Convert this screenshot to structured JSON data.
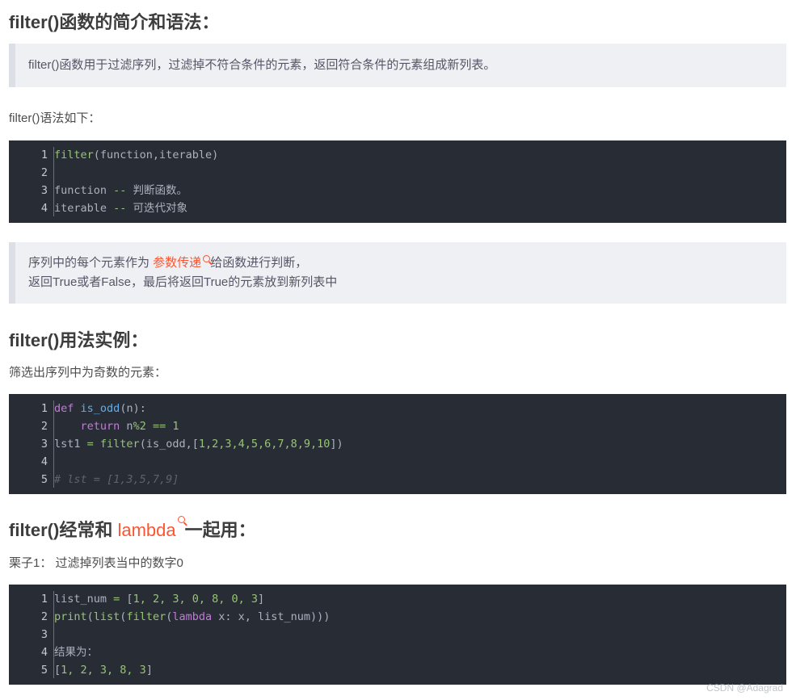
{
  "section1": {
    "heading": "filter()函数的简介和语法：",
    "quote": "filter()函数用于过滤序列，过滤掉不符合条件的元素，返回符合条件的元素组成新列表。",
    "syntax_intro": "filter()语法如下："
  },
  "code1": {
    "line_numbers": [
      "1",
      "2",
      "3",
      "4"
    ],
    "lines": {
      "l1": {
        "fn": "filter",
        "rest": "(function,iterable)"
      },
      "l3": {
        "a": "function ",
        "op": "--",
        "b": " 判断函数。"
      },
      "l4": {
        "a": "iterable ",
        "op": "--",
        "b": " 可迭代对象"
      }
    }
  },
  "quote2": {
    "before_link": "序列中的每个元素作为 ",
    "link": "参数传递",
    "after_link": "给函数进行判断，",
    "line2": "返回True或者False，最后将返回True的元素放到新列表中"
  },
  "section2": {
    "heading": "filter()用法实例：",
    "intro": "筛选出序列中为奇数的元素："
  },
  "code2": {
    "line_numbers": [
      "1",
      "2",
      "3",
      "4",
      "5"
    ],
    "l1": {
      "kw": "def",
      "sp": " ",
      "fn": "is_odd",
      "rest": "(n):"
    },
    "l2": {
      "indent": "    ",
      "kw": "return",
      "a": " n",
      "op": "%",
      "num1": "2",
      "sp": " ",
      "eq": "==",
      "sp2": " ",
      "num2": "1"
    },
    "l3": {
      "a": "lst1 ",
      "op": "=",
      "sp": " ",
      "bi": "filter",
      "b": "(is_odd,[",
      "nums": "1,2,3,4,5,6,7,8,9,10",
      "c": "])"
    },
    "l5": {
      "cm": "# lst = [1,3,5,7,9]"
    }
  },
  "section3": {
    "heading_before": "filter()经常和 ",
    "heading_link": "lambda",
    "heading_after": "一起用：",
    "example": "栗子1： 过滤掉列表当中的数字0"
  },
  "code3": {
    "line_numbers": [
      "1",
      "2",
      "3",
      "4",
      "5"
    ],
    "l1": {
      "a": "list_num ",
      "op": "=",
      "b": " [",
      "nums": "1, 2, 3, 0, 8, 0, 3",
      "c": "]"
    },
    "l2": {
      "bi1": "print",
      "p1": "(",
      "bi2": "list",
      "p2": "(",
      "bi3": "filter",
      "p3": "(",
      "kw": "lambda",
      "rest": " x: x, list_num)))"
    },
    "l4": {
      "text": "结果为："
    },
    "l5": {
      "a": "[",
      "nums": "1, 2, 3, 8, 3",
      "c": "]"
    }
  },
  "watermark": "CSDN @Adagrad"
}
